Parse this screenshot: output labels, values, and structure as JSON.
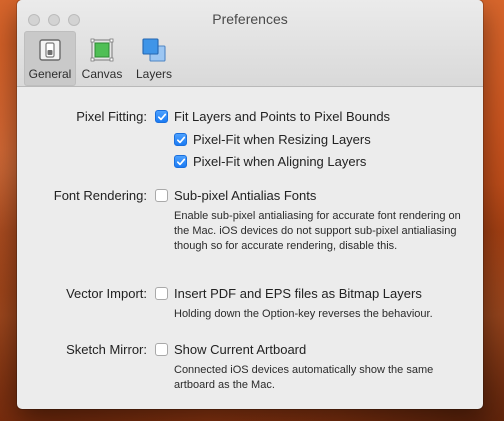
{
  "window": {
    "title": "Preferences"
  },
  "toolbar": {
    "items": [
      {
        "label": "General",
        "icon": "general-switch-icon",
        "selected": true
      },
      {
        "label": "Canvas",
        "icon": "canvas-icon",
        "selected": false
      },
      {
        "label": "Layers",
        "icon": "layers-icon",
        "selected": false
      }
    ]
  },
  "pixel_fitting": {
    "label": "Pixel Fitting:",
    "main": {
      "text": "Fit Layers and Points to Pixel Bounds",
      "checked": true
    },
    "resizing": {
      "text": "Pixel-Fit when Resizing Layers",
      "checked": true
    },
    "aligning": {
      "text": "Pixel-Fit when Aligning Layers",
      "checked": true
    }
  },
  "font_rendering": {
    "label": "Font Rendering:",
    "option": {
      "text": "Sub-pixel Antialias Fonts",
      "checked": false
    },
    "help": "Enable sub-pixel antialiasing for accurate font rendering on the Mac. iOS devices do not support sub-pixel antialiasing though so for accurate rendering, disable this."
  },
  "vector_import": {
    "label": "Vector Import:",
    "option": {
      "text": "Insert PDF and EPS files as Bitmap Layers",
      "checked": false
    },
    "help": "Holding down the Option-key reverses the behaviour."
  },
  "sketch_mirror": {
    "label": "Sketch Mirror:",
    "option": {
      "text": "Show Current Artboard",
      "checked": false
    },
    "help": "Connected iOS devices automatically show the same artboard as the Mac."
  },
  "colors": {
    "checkbox_on": "#1b7bf4",
    "wallpaper": "#c9541f"
  }
}
